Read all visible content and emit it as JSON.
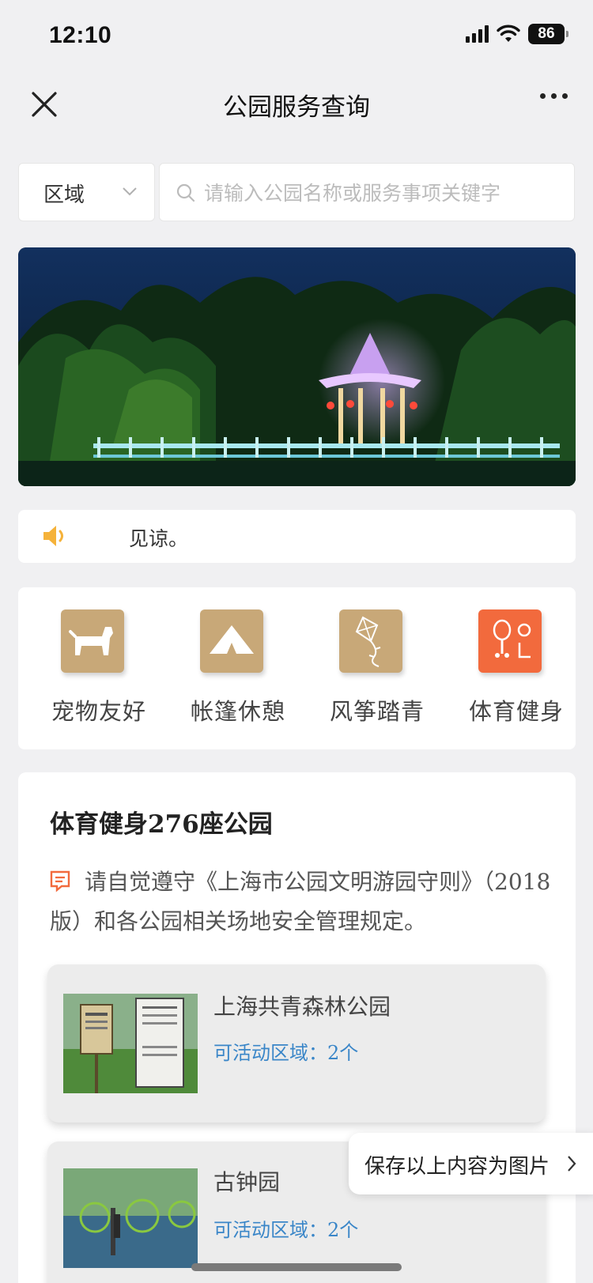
{
  "status_bar": {
    "time": "12:10",
    "battery": "86"
  },
  "nav": {
    "title": "公园服务查询"
  },
  "filter": {
    "region_label": "区域",
    "search_placeholder": "请输入公园名称或服务事项关键字"
  },
  "notice": {
    "text": "见谅。"
  },
  "services": [
    {
      "label": "宠物友好",
      "icon": "dog-icon",
      "color": "#c8a878"
    },
    {
      "label": "帐篷休憩",
      "icon": "tent-icon",
      "color": "#c8a878"
    },
    {
      "label": "风筝踏青",
      "icon": "kite-icon",
      "color": "#c8a878"
    },
    {
      "label": "体育健身",
      "icon": "sports-icon",
      "color": "#f26a3d"
    }
  ],
  "results": {
    "title": "体育健身276座公园",
    "rules": "请自觉遵守《上海市公园文明游园守则》（2018版）和各公园相关场地安全管理规定。",
    "parks": [
      {
        "name": "上海共青森林公园",
        "areas": "可活动区域：2个"
      },
      {
        "name": "古钟园",
        "areas": "可活动区域：2个"
      }
    ]
  },
  "save_button": {
    "label": "保存以上内容为图片"
  },
  "colors": {
    "accent": "#3a86c8",
    "tile_gold": "#c8a878",
    "tile_orange": "#f26a3d"
  }
}
